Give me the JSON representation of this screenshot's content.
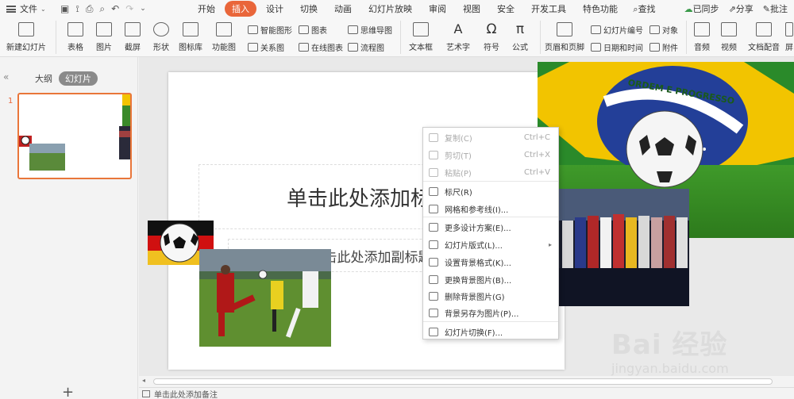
{
  "menubar": {
    "file_label": "文件",
    "tabs": [
      "开始",
      "插入",
      "设计",
      "切换",
      "动画",
      "幻灯片放映",
      "审阅",
      "视图",
      "安全",
      "开发工具",
      "特色功能"
    ],
    "active_tab": "插入",
    "search_label": "查找",
    "sync_label": "已同步",
    "share_label": "分享",
    "comment_label": "批注"
  },
  "ribbon": {
    "new_slide": "新建幻灯片",
    "table": "表格",
    "picture": "图片",
    "screenshot": "截屏",
    "shape": "形状",
    "icon_lib": "图标库",
    "func_chart": "功能图",
    "smart_shape": "智能图形",
    "chart": "图表",
    "mind_map": "思维导图",
    "relation": "关系图",
    "online_chart": "在线图表",
    "flowchart": "流程图",
    "textbox": "文本框",
    "art_text": "艺术字",
    "symbol": "符号",
    "formula": "公式",
    "header_footer": "页眉和页脚",
    "slide_number": "幻灯片编号",
    "object": "对象",
    "date_time": "日期和时间",
    "attachment": "附件",
    "audio": "音频",
    "video": "视频",
    "doc_voice": "文档配音",
    "more": "屏"
  },
  "leftpane": {
    "outline_tab": "大纲",
    "slides_tab": "幻灯片",
    "slide_number": "1",
    "add_label": "+"
  },
  "slide": {
    "title_placeholder": "单击此处添加标题",
    "subtitle_placeholder": "单击此处添加副标题"
  },
  "notes_placeholder": "单击此处添加备注",
  "context_menu": [
    {
      "label": "复制(C)",
      "shortcut": "Ctrl+C",
      "disabled": true
    },
    {
      "label": "剪切(T)",
      "shortcut": "Ctrl+X",
      "disabled": true
    },
    {
      "label": "粘贴(P)",
      "shortcut": "Ctrl+V",
      "disabled": true
    },
    {
      "label": "标尺(R)",
      "shortcut": "",
      "disabled": false
    },
    {
      "label": "网格和参考线(I)...",
      "shortcut": "",
      "disabled": false
    },
    {
      "label": "更多设计方案(E)...",
      "shortcut": "",
      "disabled": false
    },
    {
      "label": "幻灯片版式(L)...",
      "shortcut": "",
      "disabled": false,
      "submenu": true
    },
    {
      "label": "设置背景格式(K)...",
      "shortcut": "",
      "disabled": false
    },
    {
      "label": "更换背景图片(B)...",
      "shortcut": "",
      "disabled": false
    },
    {
      "label": "删除背景图片(G)",
      "shortcut": "",
      "disabled": false
    },
    {
      "label": "背景另存为图片(P)...",
      "shortcut": "",
      "disabled": false
    },
    {
      "label": "幻灯片切换(F)...",
      "shortcut": "",
      "disabled": false
    }
  ],
  "flag_banner_text": "ORDEM E PROGRESSO",
  "watermark": {
    "brand": "Bai 经验",
    "url": "jingyan.baidu.com"
  },
  "colors": {
    "accent": "#e9663a",
    "thumb_border": "#e9763a"
  }
}
